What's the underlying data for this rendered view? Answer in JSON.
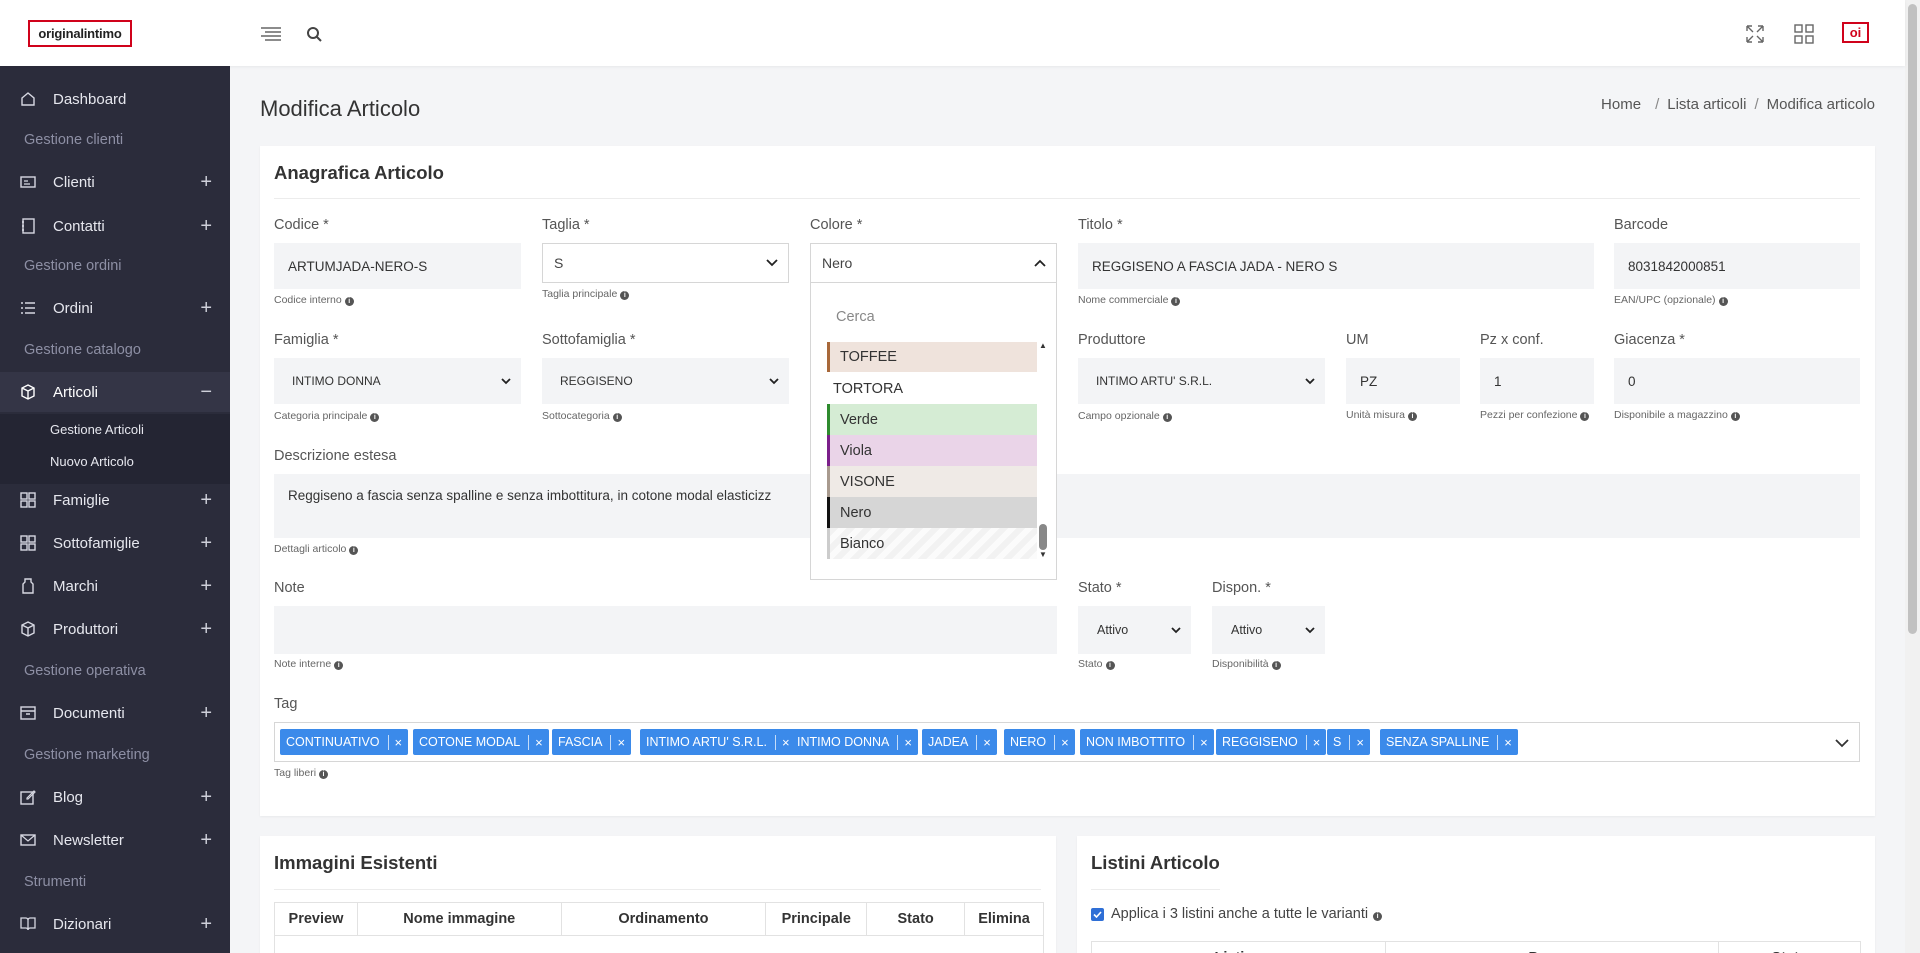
{
  "brand": {
    "logo_text": "originalintimo",
    "badge": "oi"
  },
  "topbar": {
    "menu_icon": "menu-icon",
    "search_icon": "search-icon",
    "fullscreen_icon": "fullscreen-icon",
    "apps_icon": "apps-grid-icon"
  },
  "sidebar": {
    "dashboard": "Dashboard",
    "sec_clienti": "Gestione clienti",
    "clienti": "Clienti",
    "contatti": "Contatti",
    "sec_ordini": "Gestione ordini",
    "ordini": "Ordini",
    "sec_catalogo": "Gestione catalogo",
    "articoli": "Articoli",
    "gestione_articoli": "Gestione Articoli",
    "nuovo_articolo": "Nuovo Articolo",
    "famiglie": "Famiglie",
    "sottofamiglie": "Sottofamiglie",
    "marchi": "Marchi",
    "produttori": "Produttori",
    "sec_operativa": "Gestione operativa",
    "documenti": "Documenti",
    "sec_marketing": "Gestione marketing",
    "blog": "Blog",
    "newsletter": "Newsletter",
    "sec_strumenti": "Strumenti",
    "dizionari": "Dizionari",
    "plus": "+",
    "minus": "−"
  },
  "page": {
    "title": "Modifica Articolo",
    "breadcrumb": [
      "Home",
      "Lista articoli",
      "Modifica articolo"
    ],
    "sep": "/"
  },
  "form": {
    "card_title": "Anagrafica Articolo",
    "codice": {
      "label": "Codice *",
      "value": "ARTUMJADA-NERO-S",
      "help": "Codice interno"
    },
    "taglia": {
      "label": "Taglia *",
      "value": "S",
      "help": "Taglia principale"
    },
    "colore": {
      "label": "Colore *",
      "value": "Nero"
    },
    "titolo": {
      "label": "Titolo *",
      "value": "REGGISENO A FASCIA JADA - NERO S",
      "help": "Nome commerciale"
    },
    "barcode": {
      "label": "Barcode",
      "value": "8031842000851",
      "help": "EAN/UPC (opzionale)"
    },
    "famiglia": {
      "label": "Famiglia *",
      "value": "INTIMO DONNA",
      "help": "Categoria principale"
    },
    "sottofamiglia": {
      "label": "Sottofamiglia *",
      "value": "REGGISENO",
      "help": "Sottocategoria"
    },
    "produttore": {
      "label": "Produttore",
      "value": "INTIMO ARTU' S.R.L.",
      "help": "Campo opzionale"
    },
    "um": {
      "label": "UM",
      "value": "PZ",
      "help": "Unità misura"
    },
    "pz": {
      "label": "Pz x conf.",
      "value": "1",
      "help": "Pezzi per confezione"
    },
    "giacenza": {
      "label": "Giacenza *",
      "value": "0",
      "help": "Disponibile a magazzino"
    },
    "descrizione": {
      "label": "Descrizione estesa",
      "value": "Reggiseno a fascia senza spalline e senza imbottitura, in cotone modal elasticizz",
      "help": "Dettagli articolo"
    },
    "note": {
      "label": "Note",
      "value": "",
      "help": "Note interne"
    },
    "stato": {
      "label": "Stato *",
      "value": "Attivo",
      "help": "Stato"
    },
    "dispon": {
      "label": "Dispon. *",
      "value": "Attivo",
      "help": "Disponibilità"
    },
    "tag": {
      "label": "Tag",
      "help": "Tag liberi",
      "x": "×",
      "values": [
        "CONTINUATIVO",
        "COTONE MODAL",
        "FASCIA",
        "INTIMO ARTU' S.R.L.",
        "INTIMO DONNA",
        "JADEA",
        "NERO",
        "NON IMBOTTITO",
        "REGGISENO",
        "S",
        "SENZA SPALLINE"
      ]
    },
    "info_icon": "info-icon"
  },
  "dropdown": {
    "placeholder": "Cerca",
    "options": [
      {
        "label": "TOFFEE",
        "color": "#a8683a",
        "bg": "#efe3dc"
      },
      {
        "label": "TORTORA",
        "color": "",
        "bg": "#ffffff"
      },
      {
        "label": "Verde",
        "color": "#2e8b2e",
        "bg": "#d5ecd4"
      },
      {
        "label": "Viola",
        "color": "#7b1f8a",
        "bg": "#ead4e8"
      },
      {
        "label": "VISONE",
        "color": "#a89a8e",
        "bg": "#efeae6"
      },
      {
        "label": "Nero",
        "color": "#111111",
        "bg": "#d6d6d6"
      },
      {
        "label": "Bianco",
        "color": "#cccccc",
        "bg": "#f2f2f2"
      }
    ]
  },
  "images_card": {
    "title": "Immagini Esistenti",
    "headers": [
      "Preview",
      "Nome immagine",
      "Ordinamento",
      "Principale",
      "Stato",
      "Elimina"
    ]
  },
  "listini_card": {
    "title": "Listini Articolo",
    "checkbox_label": "Applica i 3 listini anche a tutte le varianti",
    "headers": [
      "Listino",
      "Prezzo",
      "Stato"
    ]
  }
}
